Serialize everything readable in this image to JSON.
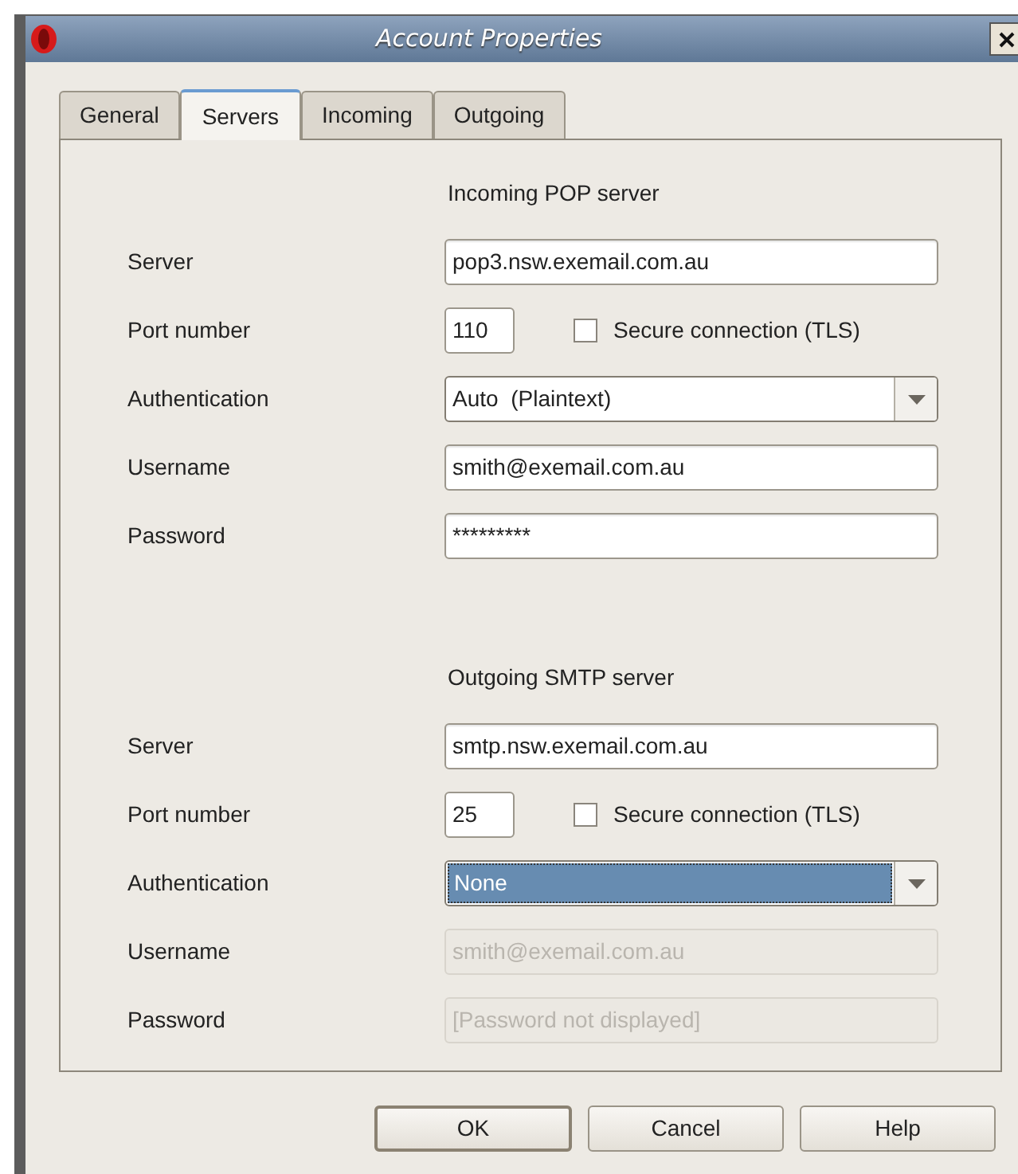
{
  "window": {
    "title": "Account Properties"
  },
  "tabs": [
    {
      "label": "General",
      "selected": false
    },
    {
      "label": "Servers",
      "selected": true
    },
    {
      "label": "Incoming",
      "selected": false
    },
    {
      "label": "Outgoing",
      "selected": false
    }
  ],
  "sections": [
    {
      "heading": "Incoming POP server",
      "rows": [
        {
          "kind": "text",
          "label": "Server",
          "value": "pop3.nsw.exemail.com.au",
          "disabled": false
        },
        {
          "kind": "port",
          "label": "Port number",
          "value": "110",
          "checkbox": {
            "label": "Secure connection (TLS)",
            "checked": false
          }
        },
        {
          "kind": "dropdown",
          "label": "Authentication",
          "value": "Auto  (Plaintext)",
          "selected": false
        },
        {
          "kind": "text",
          "label": "Username",
          "value": "smith@exemail.com.au",
          "disabled": false
        },
        {
          "kind": "text",
          "label": "Password",
          "value": "*********",
          "disabled": false
        }
      ]
    },
    {
      "heading": "Outgoing SMTP server",
      "rows": [
        {
          "kind": "text",
          "label": "Server",
          "value": "smtp.nsw.exemail.com.au",
          "disabled": false
        },
        {
          "kind": "port",
          "label": "Port number",
          "value": "25",
          "checkbox": {
            "label": "Secure connection (TLS)",
            "checked": false
          }
        },
        {
          "kind": "dropdown",
          "label": "Authentication",
          "value": "None",
          "selected": true
        },
        {
          "kind": "text",
          "label": "Username",
          "value": "smith@exemail.com.au",
          "disabled": true
        },
        {
          "kind": "text",
          "label": "Password",
          "value": "[Password not displayed]",
          "disabled": true
        }
      ]
    }
  ],
  "buttons": [
    {
      "label": "OK",
      "default": true
    },
    {
      "label": "Cancel",
      "default": false
    },
    {
      "label": "Help",
      "default": false
    }
  ]
}
